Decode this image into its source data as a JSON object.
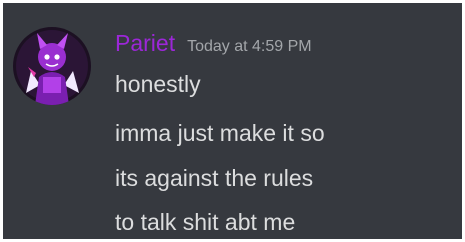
{
  "message": {
    "author": {
      "name": "Pariet",
      "name_color": "#9c27d8"
    },
    "timestamp": "Today at 4:59 PM",
    "avatar_icon": "purple-character-avatar-icon",
    "lines": [
      "honestly",
      "imma just make it so",
      "its against the rules",
      "to talk shit abt me"
    ]
  },
  "colors": {
    "background": "#36393f",
    "text": "#dcddde",
    "timestamp": "#a3a6aa"
  }
}
